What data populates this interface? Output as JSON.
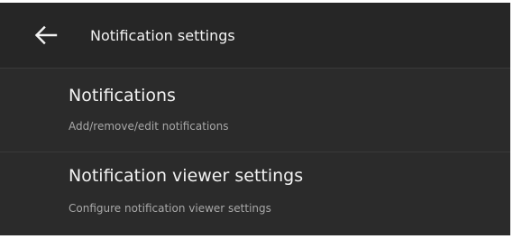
{
  "header": {
    "back_icon": "arrow-left-icon",
    "title": "Notification settings"
  },
  "items": [
    {
      "title": "Notifications",
      "subtitle": "Add/remove/edit notifications"
    },
    {
      "title": "Notification viewer settings",
      "subtitle": "Configure notification viewer settings"
    }
  ],
  "colors": {
    "header_background": "#262626",
    "panel_background": "#2b2b2b",
    "title_text": "#f2f2f2",
    "subtitle_text": "#a8a8a8"
  }
}
